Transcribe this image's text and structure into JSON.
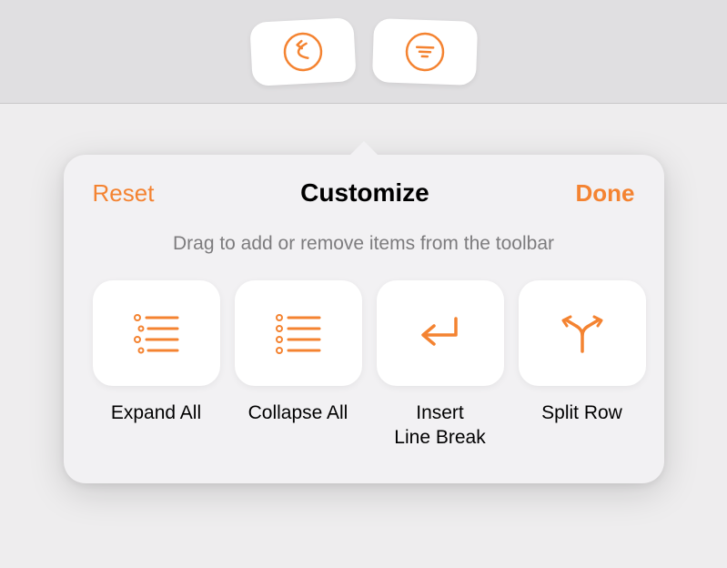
{
  "colors": {
    "accent": "#f48331",
    "text_primary": "#000000",
    "text_secondary": "#7d7c7e",
    "background": "#eeedee",
    "top_bar": "#e0dfe1",
    "popover": "#f2f1f3",
    "item_bg": "#ffffff"
  },
  "toolbar": {
    "icons": [
      "undo-icon",
      "filter-lines-icon"
    ]
  },
  "popover": {
    "reset_label": "Reset",
    "title": "Customize",
    "done_label": "Done",
    "instruction": "Drag to add or remove items from the toolbar",
    "items": [
      {
        "label": "Expand All",
        "icon": "expand-all-icon"
      },
      {
        "label": "Collapse All",
        "icon": "collapse-all-icon"
      },
      {
        "label": "Insert\nLine Break",
        "icon": "insert-line-break-icon"
      },
      {
        "label": "Split Row",
        "icon": "split-row-icon"
      }
    ]
  }
}
